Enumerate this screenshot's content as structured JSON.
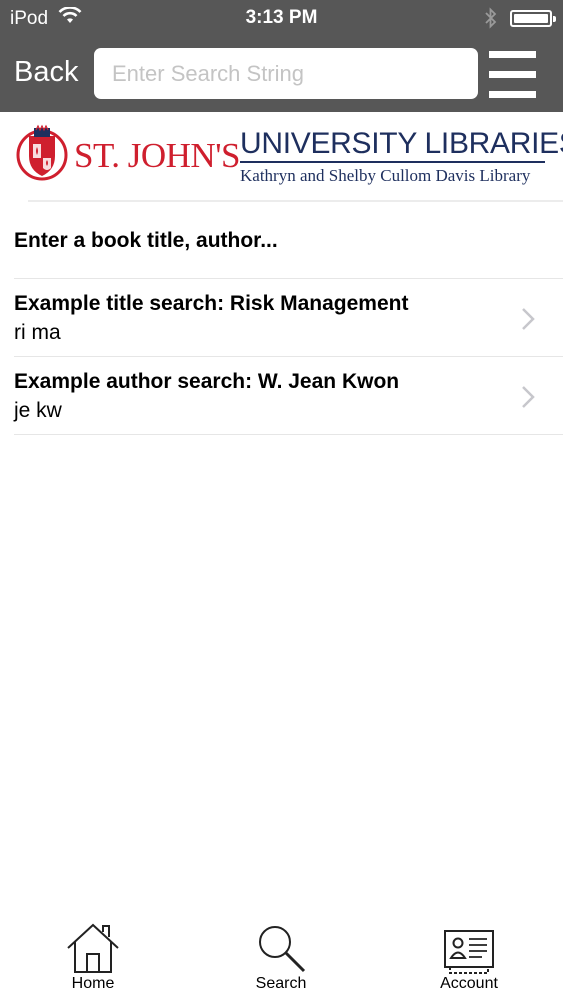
{
  "status_bar": {
    "carrier": "iPod",
    "time": "3:13 PM"
  },
  "nav": {
    "back_label": "Back",
    "search_placeholder": "Enter Search String"
  },
  "banner": {
    "institution": "ST. JOHN'S",
    "library": "UNIVERSITY LIBRARIES",
    "library_sub": "Kathryn and Shelby Cullom Davis Library",
    "colors": {
      "red": "#cf1f2e",
      "navy": "#1e2f5e"
    }
  },
  "prompt": "Enter a book title, author...",
  "examples": [
    {
      "title": "Example title search: Risk Management",
      "subtitle": "ri ma"
    },
    {
      "title": "Example author search: W. Jean Kwon",
      "subtitle": "je kw"
    }
  ],
  "tabs": [
    {
      "label": "Home",
      "icon": "home-icon"
    },
    {
      "label": "Search",
      "icon": "search-icon"
    },
    {
      "label": "Account",
      "icon": "account-icon"
    }
  ]
}
